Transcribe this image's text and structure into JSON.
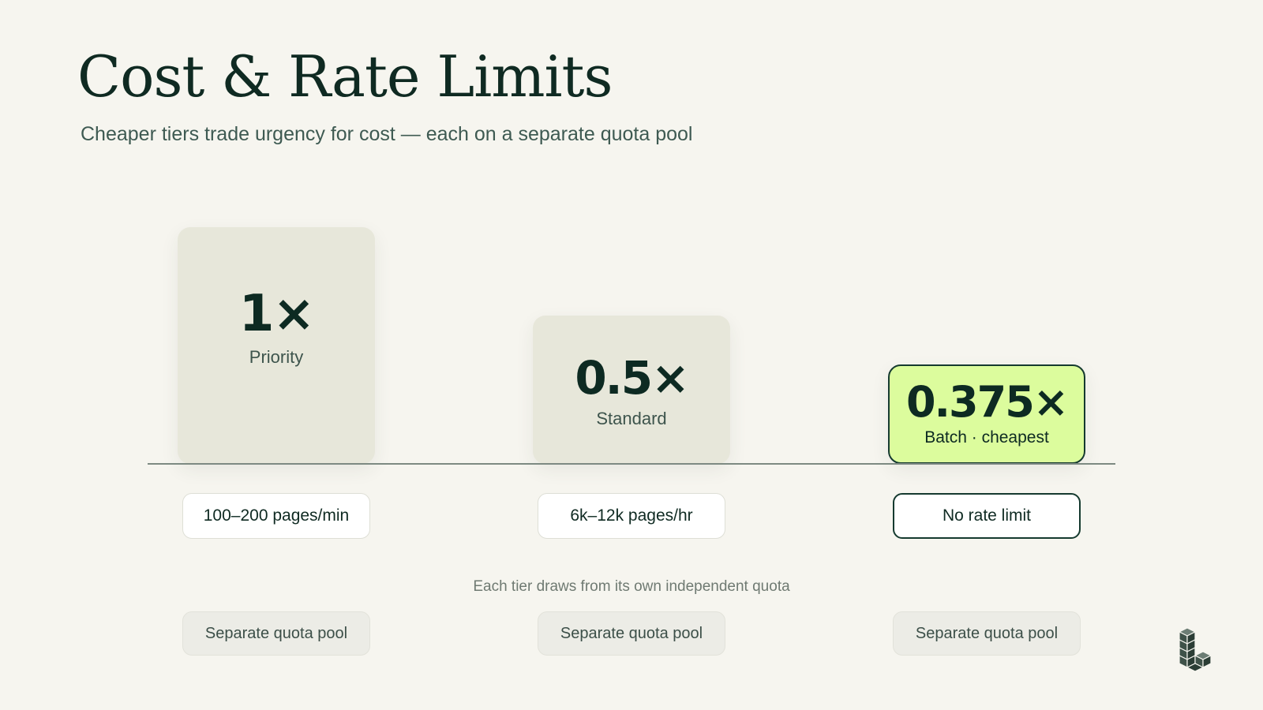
{
  "title": "Cost & Rate Limits",
  "subtitle": "Cheaper tiers trade urgency for cost — each on a separate quota pool",
  "chart_data": {
    "type": "bar",
    "categories": [
      "Priority",
      "Standard",
      "Batch · cheapest"
    ],
    "values": [
      1,
      0.5,
      0.375
    ],
    "value_labels": [
      "1×",
      "0.5×",
      "0.375×"
    ],
    "highlight_index": 2,
    "ylim": [
      0,
      1
    ],
    "grid": false,
    "colors": {
      "bar": "#e7e7da",
      "highlight_bar": "#dcfc9d",
      "highlight_border": "#153a2f",
      "baseline": "#7d8a82"
    }
  },
  "rate_limits": [
    "100–200 pages/min",
    "6k–12k pages/hr",
    "No rate limit"
  ],
  "note": "Each tier draws from its own independent quota",
  "quota_pools": [
    "Separate quota pool",
    "Separate quota pool",
    "Separate quota pool"
  ],
  "logo_icon": "stacked-blocks-logo-icon"
}
